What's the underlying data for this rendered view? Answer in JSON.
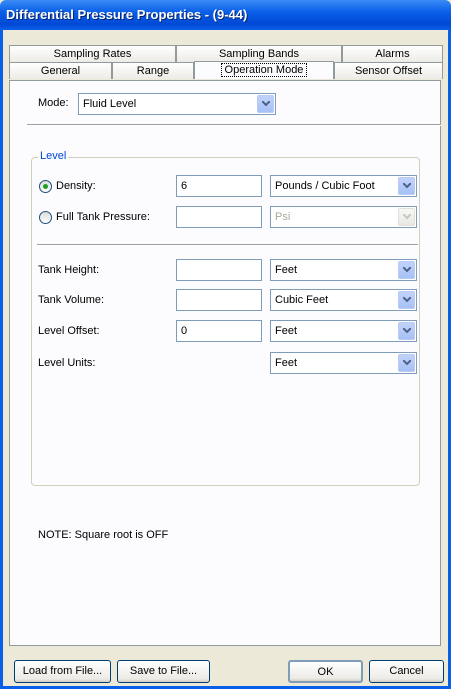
{
  "window": {
    "title": "Differential Pressure Properties -  (9-44)"
  },
  "tabs": {
    "row1": [
      "Sampling Rates",
      "Sampling Bands",
      "Alarms"
    ],
    "row2": [
      "General",
      "Range",
      "Operation Mode",
      "Sensor Offset"
    ],
    "active": "Operation Mode"
  },
  "mode": {
    "label": "Mode:",
    "value": "Fluid Level"
  },
  "level": {
    "group_label": "Level",
    "density": {
      "label": "Density:",
      "value": "6",
      "unit": "Pounds / Cubic Foot",
      "selected": true
    },
    "full_tank": {
      "label": "Full Tank Pressure:",
      "value": "",
      "unit": "Psi",
      "selected": false
    },
    "tank_height": {
      "label": "Tank Height:",
      "value": "",
      "unit": "Feet"
    },
    "tank_volume": {
      "label": "Tank Volume:",
      "value": "",
      "unit": "Cubic Feet"
    },
    "level_offset": {
      "label": "Level Offset:",
      "value": "0",
      "unit": "Feet"
    },
    "level_units": {
      "label": "Level Units:",
      "unit": "Feet"
    }
  },
  "note": "NOTE: Square root is OFF",
  "buttons": {
    "load": "Load from File...",
    "save": "Save to File...",
    "ok": "OK",
    "cancel": "Cancel"
  },
  "colors": {
    "titlebar": "#0A5FE8",
    "group_label": "#0046D5",
    "radio_dot": "#21A121"
  }
}
